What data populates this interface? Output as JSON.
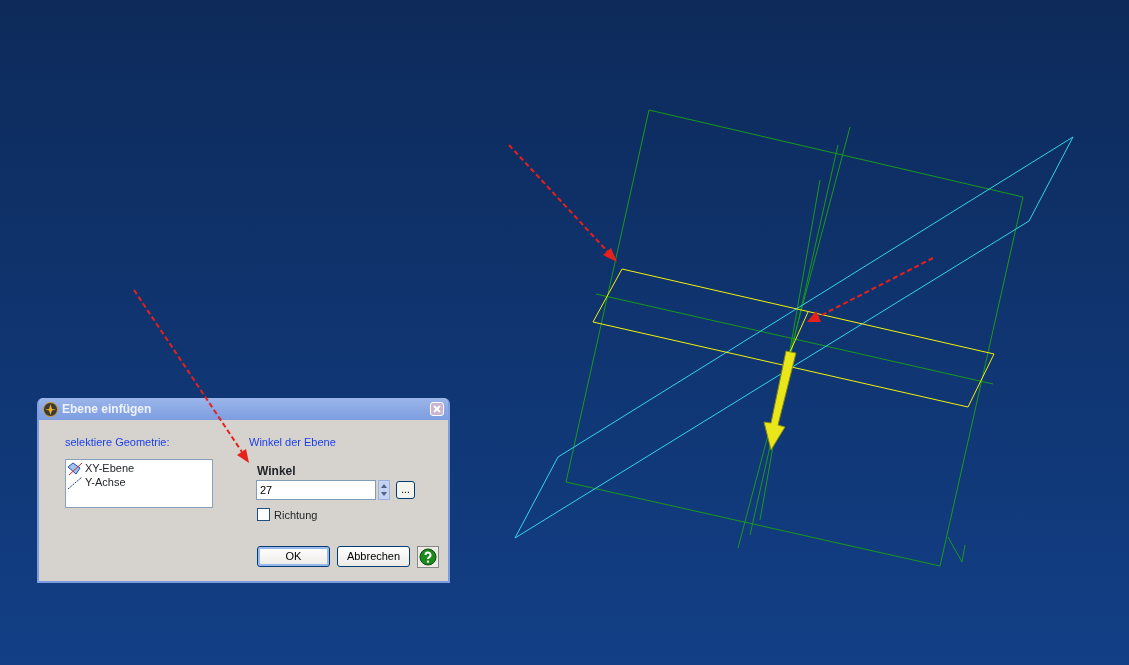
{
  "dialog": {
    "title": "Ebene einfügen",
    "geometry_label": "selektiere Geometrie:",
    "geometry_items": [
      {
        "kind": "plane",
        "label": "XY-Ebene"
      },
      {
        "kind": "axis",
        "label": "Y-Achse"
      }
    ],
    "angle_section": "Winkel der Ebene",
    "angle_label": "Winkel",
    "angle_value": "27",
    "browse_button": "...",
    "direction": {
      "label": "Richtung",
      "checked": false
    },
    "buttons": [
      {
        "kind": "ok",
        "label": "OK"
      },
      {
        "kind": "cancel",
        "label": "Abbrechen"
      }
    ]
  }
}
